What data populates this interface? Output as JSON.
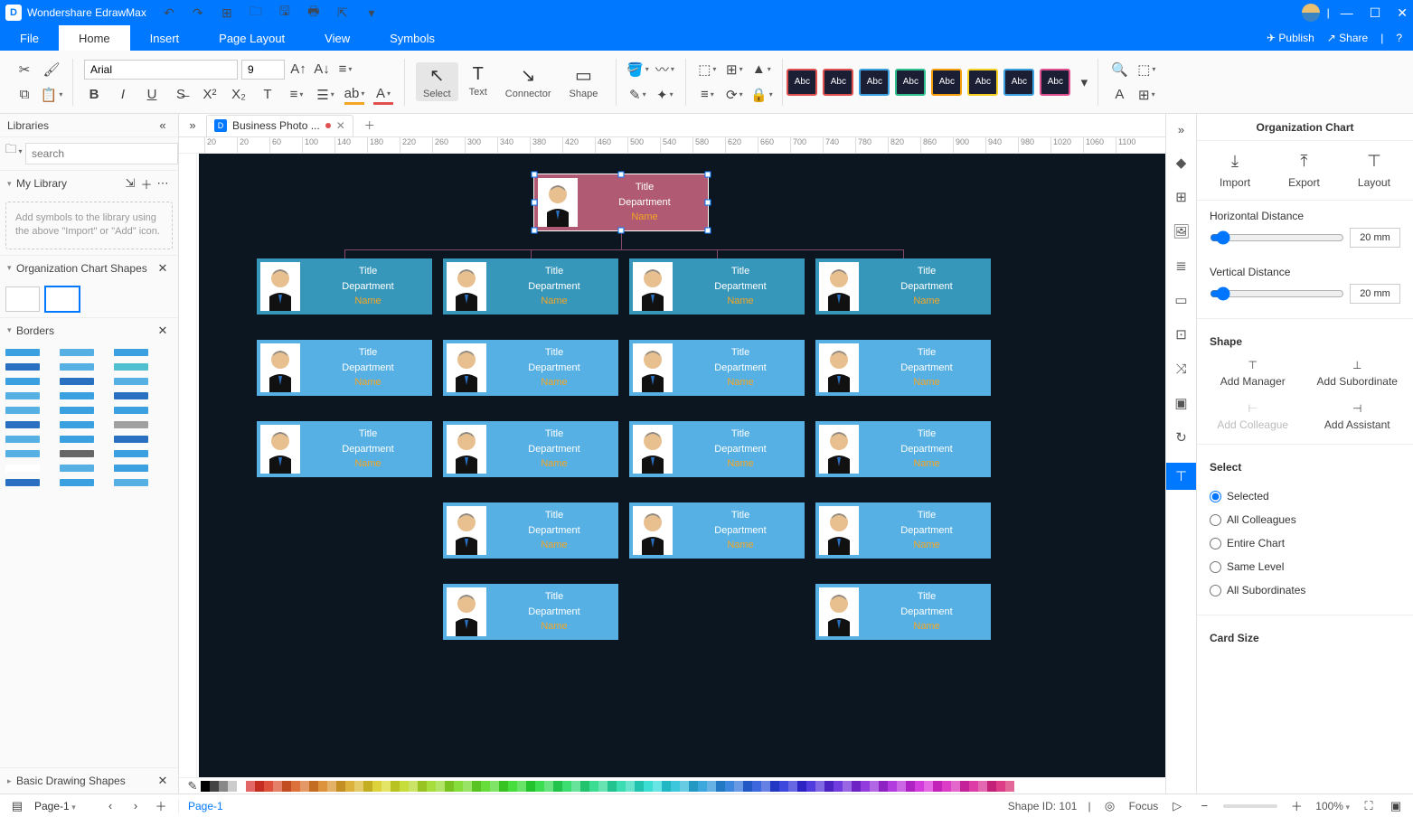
{
  "app": {
    "name": "Wondershare EdrawMax"
  },
  "qat": {
    "undo": "↶",
    "redo": "↷",
    "new": "⊞",
    "open": "🗀",
    "save": "🖫",
    "print": "🖶",
    "export": "⇱",
    "more": "▾"
  },
  "win": {
    "min": "—",
    "max": "☐",
    "close": "✕",
    "sep": "|"
  },
  "menu": {
    "file": "File",
    "home": "Home",
    "insert": "Insert",
    "layout": "Page Layout",
    "view": "View",
    "symbols": "Symbols",
    "publish": "Publish",
    "share": "Share",
    "help": "?"
  },
  "ribbon": {
    "font": "Arial",
    "size": "9",
    "tools": {
      "select": "Select",
      "text": "Text",
      "connector": "Connector",
      "shape": "Shape"
    },
    "themes": [
      "#1a1f36",
      "#1a1f36",
      "#1a1f36",
      "#1a1f36",
      "#1a1f36",
      "#1a1f36",
      "#1a1f36",
      "#1a1f36"
    ],
    "themeBorders": [
      "#e05050",
      "#e05050",
      "#3aa0e0",
      "#30c090",
      "#f59e0b",
      "#f5d020",
      "#3aa0e0",
      "#e05090"
    ]
  },
  "left": {
    "title": "Libraries",
    "search": "search",
    "mylib": "My Library",
    "hint": "Add symbols to the library using the above \"Import\" or \"Add\" icon.",
    "orgshapes": "Organization Chart Shapes",
    "borders": "Borders",
    "basic": "Basic Drawing Shapes"
  },
  "doc": {
    "tab": "Business Photo ..."
  },
  "node": {
    "title": "Title",
    "dept": "Department",
    "name": "Name"
  },
  "rp": {
    "title": "Organization Chart",
    "import": "Import",
    "export": "Export",
    "layout": "Layout",
    "hdist": "Horizontal Distance",
    "vdist": "Vertical Distance",
    "dist": "20 mm",
    "shape": "Shape",
    "addmgr": "Add Manager",
    "addsub": "Add Subordinate",
    "addcol": "Add Colleague",
    "addast": "Add Assistant",
    "select": "Select",
    "r1": "Selected",
    "r2": "All Colleagues",
    "r3": "Entire Chart",
    "r4": "Same Level",
    "r5": "All Subordinates",
    "card": "Card Size"
  },
  "status": {
    "page": "Page-1",
    "page2": "Page-1",
    "shapeid": "Shape ID: 101",
    "focus": "Focus",
    "zoom": "100%"
  },
  "themeLabel": "Abc",
  "borderColors": [
    "#3aa0e0",
    "#56b0e4",
    "#3aa0e0",
    "#2a70c0",
    "#56b0e4",
    "#50c0d0",
    "#3aa0e0",
    "#2a70c0",
    "#56b0e4",
    "#56b0e4",
    "#3aa0e0",
    "#2a70c0",
    "#56b0e4",
    "#3aa0e0",
    "#3aa0e0",
    "#2a70c0",
    "#3aa0e0",
    "#a0a0a0",
    "#56b0e4",
    "#3aa0e0",
    "#2a70c0",
    "#56b0e4",
    "#666",
    "#3aa0e0",
    "#fff",
    "#56b0e4",
    "#3aa0e0",
    "#2a70c0",
    "#3aa0e0",
    "#56b0e4"
  ]
}
